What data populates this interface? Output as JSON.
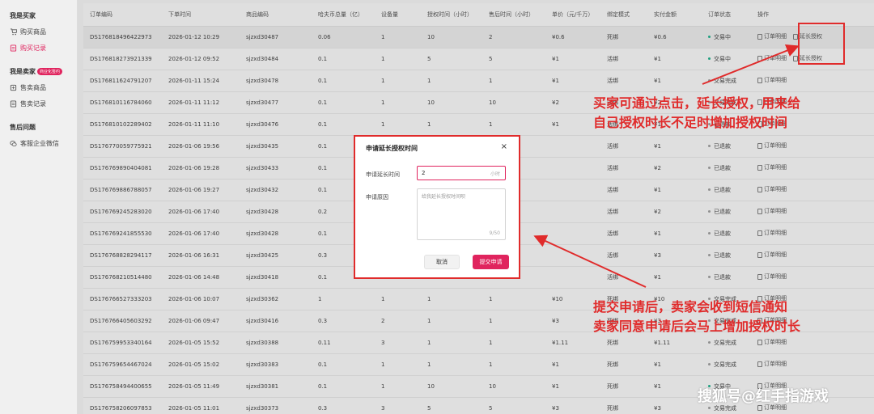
{
  "sidebar": {
    "buyer_group": "我是买家",
    "buyer_items": [
      {
        "label": "购买商品",
        "icon": "cart-icon",
        "active": false
      },
      {
        "label": "购买记录",
        "icon": "document-icon",
        "active": true
      }
    ],
    "seller_group": "我是卖家",
    "seller_badge": "商业化签约",
    "seller_items": [
      {
        "label": "售卖商品",
        "icon": "box-icon"
      },
      {
        "label": "售卖记录",
        "icon": "document-icon"
      }
    ],
    "after_group": "售后问题",
    "after_items": [
      {
        "label": "客服企业微信",
        "icon": "wechat-icon"
      }
    ]
  },
  "table": {
    "headers": [
      "订单编码",
      "下单时间",
      "商品编码",
      "哈夫币总量（亿）",
      "设备量",
      "授权时间（小时）",
      "售后时间（小时）",
      "单价（元/千万）",
      "绑定模式",
      "实付金额",
      "订单状态",
      "操作"
    ],
    "rows": [
      [
        "DS176818496422973",
        "2026-01-12 10:29",
        "sjzxd30487",
        "0.06",
        "1",
        "10",
        "2",
        "¥0.6",
        "死绑",
        "¥0.6",
        "交易中"
      ],
      [
        "DS176818273921339",
        "2026-01-12 09:52",
        "sjzxd30484",
        "0.1",
        "1",
        "5",
        "5",
        "¥1",
        "活绑",
        "¥1",
        "交易中"
      ],
      [
        "DS176811624791207",
        "2026-01-11 15:24",
        "sjzxd30478",
        "0.1",
        "1",
        "1",
        "1",
        "¥1",
        "活绑",
        "¥1",
        "交易完成"
      ],
      [
        "DS176810116784060",
        "2026-01-11 11:12",
        "sjzxd30477",
        "0.1",
        "1",
        "10",
        "10",
        "¥2",
        "活绑",
        "¥2",
        "交易完成"
      ],
      [
        "DS176810102289402",
        "2026-01-11 11:10",
        "sjzxd30476",
        "0.1",
        "1",
        "1",
        "1",
        "¥1",
        "活绑",
        "¥1",
        "已退款"
      ],
      [
        "DS176770059775921",
        "2026-01-06 19:56",
        "sjzxd30435",
        "0.1",
        "",
        "",
        "",
        "",
        "活绑",
        "¥1",
        "已退款"
      ],
      [
        "DS176769890404081",
        "2026-01-06 19:28",
        "sjzxd30433",
        "0.1",
        "",
        "",
        "",
        "",
        "活绑",
        "¥2",
        "已退款"
      ],
      [
        "DS176769886788057",
        "2026-01-06 19:27",
        "sjzxd30432",
        "0.1",
        "",
        "",
        "",
        "",
        "活绑",
        "¥1",
        "已退款"
      ],
      [
        "DS176769245283020",
        "2026-01-06 17:40",
        "sjzxd30428",
        "0.2",
        "",
        "",
        "",
        "",
        "活绑",
        "¥2",
        "已退款"
      ],
      [
        "DS176769241855530",
        "2026-01-06 17:40",
        "sjzxd30428",
        "0.1",
        "",
        "",
        "",
        "",
        "活绑",
        "¥1",
        "已退款"
      ],
      [
        "DS176768828294117",
        "2026-01-06 16:31",
        "sjzxd30425",
        "0.3",
        "",
        "",
        "",
        "",
        "活绑",
        "¥3",
        "已退款"
      ],
      [
        "DS176768210514480",
        "2026-01-06 14:48",
        "sjzxd30418",
        "0.1",
        "",
        "",
        "",
        "",
        "活绑",
        "¥1",
        "已退款"
      ],
      [
        "DS176766527333203",
        "2026-01-06 10:07",
        "sjzxd30362",
        "1",
        "1",
        "1",
        "1",
        "¥10",
        "死绑",
        "¥10",
        "交易完成"
      ],
      [
        "DS176766405603292",
        "2026-01-06 09:47",
        "sjzxd30416",
        "0.3",
        "2",
        "1",
        "1",
        "¥3",
        "死绑",
        "¥3",
        "交易完成"
      ],
      [
        "DS176759953340164",
        "2026-01-05 15:52",
        "sjzxd30388",
        "0.11",
        "3",
        "1",
        "1",
        "¥1.11",
        "死绑",
        "¥1.11",
        "交易完成"
      ],
      [
        "DS176759654467024",
        "2026-01-05 15:02",
        "sjzxd30383",
        "0.1",
        "1",
        "1",
        "1",
        "¥1",
        "死绑",
        "¥1",
        "交易完成"
      ],
      [
        "DS176758494400655",
        "2026-01-05 11:49",
        "sjzxd30381",
        "0.1",
        "1",
        "10",
        "10",
        "¥1",
        "死绑",
        "¥1",
        "交易中"
      ],
      [
        "DS176758206097853",
        "2026-01-05 11:01",
        "sjzxd30373",
        "0.3",
        "3",
        "5",
        "5",
        "¥3",
        "死绑",
        "¥3",
        "交易完成"
      ]
    ],
    "op_detail": "订单明细",
    "op_extend": "延长授权",
    "status_colors": {
      "交易中": "#22aa88",
      "交易完成": "#999999",
      "已退款": "#999999"
    }
  },
  "modal": {
    "title": "申请延长授权时间",
    "close": "×",
    "time_label": "申请延长时间",
    "time_value": "2",
    "time_unit": "小时",
    "reason_label": "申请原因",
    "reason_placeholder": "给我延长授权时间呗",
    "reason_count": "9/50",
    "cancel": "取消",
    "submit": "提交申请"
  },
  "annotations": {
    "a1_line1": "买家可通过点击，延长授权，用来给",
    "a1_line2": "自己授权时长不足时增加授权时间",
    "a2_line1": "提交申请后，卖家会收到短信通知",
    "a2_line2": "卖家同意申请后会马上增加授权时长"
  },
  "watermark": "搜狐号@红手指游戏",
  "colors": {
    "accent": "#e0245e",
    "annotation": "#e02b2b"
  }
}
